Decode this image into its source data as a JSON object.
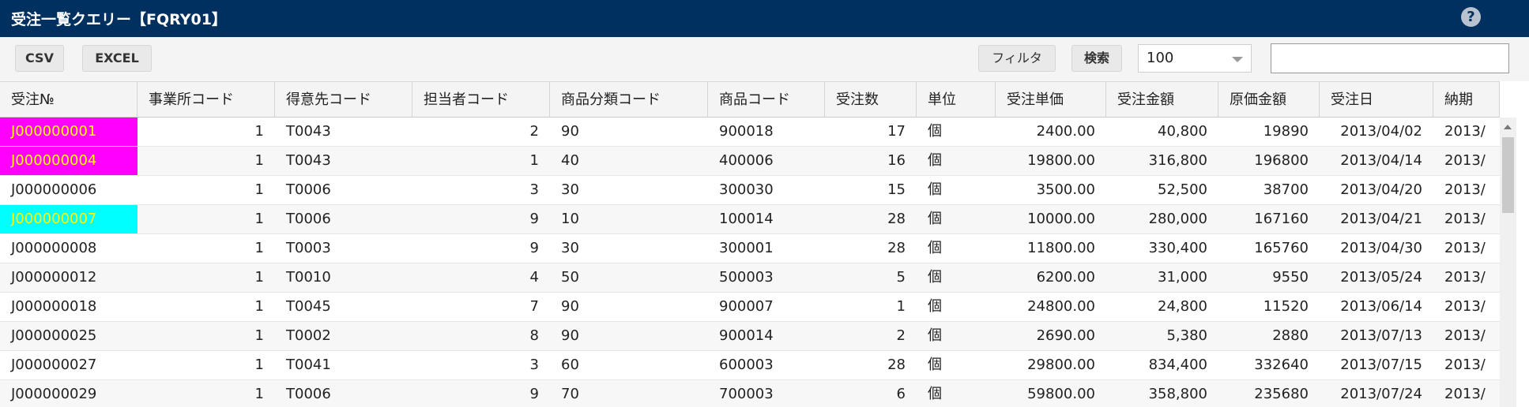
{
  "window": {
    "title": "受注一覧クエリー【FQRY01】",
    "help_icon": "?"
  },
  "toolbar": {
    "csv_label": "CSV",
    "excel_label": "EXCEL",
    "filter_label": "フィルタ",
    "search_label": "検索",
    "page_size_value": "100",
    "search_value": ""
  },
  "colors": {
    "header_bg": "#00305f",
    "highlight_magenta": "#ff00ff",
    "highlight_cyan": "#00ffff",
    "highlight_text": "#ffff00"
  },
  "grid": {
    "columns": [
      "受注№",
      "事業所コード",
      "得意先コード",
      "担当者コード",
      "商品分類コード",
      "商品コード",
      "受注数",
      "単位",
      "受注単価",
      "受注金額",
      "原価金額",
      "受注日",
      "納期"
    ],
    "rows": [
      {
        "highlight": "magenta",
        "cells": [
          "J000000001",
          "1",
          "T0043",
          "2",
          "90",
          "900018",
          "17",
          "個",
          "2400.00",
          "40,800",
          "19890",
          "2013/04/02",
          "2013/"
        ]
      },
      {
        "highlight": "magenta",
        "cells": [
          "J000000004",
          "1",
          "T0043",
          "1",
          "40",
          "400006",
          "16",
          "個",
          "19800.00",
          "316,800",
          "196800",
          "2013/04/14",
          "2013/"
        ]
      },
      {
        "highlight": "",
        "cells": [
          "J000000006",
          "1",
          "T0006",
          "3",
          "30",
          "300030",
          "15",
          "個",
          "3500.00",
          "52,500",
          "38700",
          "2013/04/20",
          "2013/"
        ]
      },
      {
        "highlight": "cyan",
        "cells": [
          "J000000007",
          "1",
          "T0006",
          "9",
          "10",
          "100014",
          "28",
          "個",
          "10000.00",
          "280,000",
          "167160",
          "2013/04/21",
          "2013/"
        ]
      },
      {
        "highlight": "",
        "cells": [
          "J000000008",
          "1",
          "T0003",
          "9",
          "30",
          "300001",
          "28",
          "個",
          "11800.00",
          "330,400",
          "165760",
          "2013/04/30",
          "2013/"
        ]
      },
      {
        "highlight": "",
        "cells": [
          "J000000012",
          "1",
          "T0010",
          "4",
          "50",
          "500003",
          "5",
          "個",
          "6200.00",
          "31,000",
          "9550",
          "2013/05/24",
          "2013/"
        ]
      },
      {
        "highlight": "",
        "cells": [
          "J000000018",
          "1",
          "T0045",
          "7",
          "90",
          "900007",
          "1",
          "個",
          "24800.00",
          "24,800",
          "11520",
          "2013/06/14",
          "2013/"
        ]
      },
      {
        "highlight": "",
        "cells": [
          "J000000025",
          "1",
          "T0002",
          "8",
          "90",
          "900014",
          "2",
          "個",
          "2690.00",
          "5,380",
          "2880",
          "2013/07/13",
          "2013/"
        ]
      },
      {
        "highlight": "",
        "cells": [
          "J000000027",
          "1",
          "T0041",
          "3",
          "60",
          "600003",
          "28",
          "個",
          "29800.00",
          "834,400",
          "332640",
          "2013/07/15",
          "2013/"
        ]
      },
      {
        "highlight": "",
        "cells": [
          "J000000029",
          "1",
          "T0006",
          "9",
          "70",
          "700003",
          "6",
          "個",
          "59800.00",
          "358,800",
          "235680",
          "2013/07/24",
          "2013/"
        ]
      }
    ]
  }
}
